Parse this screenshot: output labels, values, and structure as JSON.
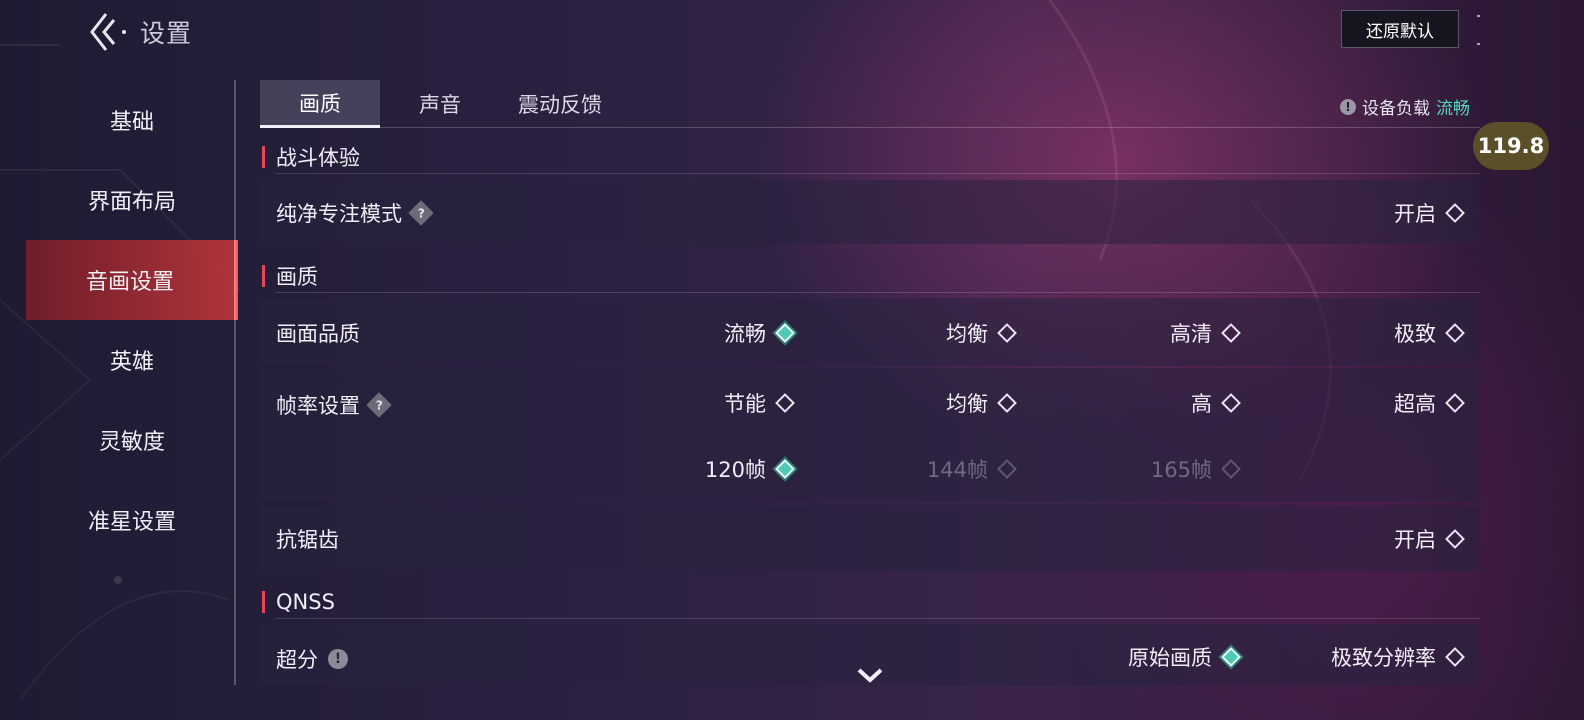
{
  "header": {
    "title": "设置",
    "reset_label": "还原默认"
  },
  "sidebar": {
    "items": [
      {
        "label": "基础"
      },
      {
        "label": "界面布局"
      },
      {
        "label": "音画设置"
      },
      {
        "label": "英雄"
      },
      {
        "label": "灵敏度"
      },
      {
        "label": "准星设置"
      }
    ],
    "active_index": 2
  },
  "tabs": [
    {
      "label": "画质"
    },
    {
      "label": "声音"
    },
    {
      "label": "震动反馈"
    }
  ],
  "device_load": {
    "label": "设备负载",
    "value": "流畅",
    "value_color": "#56d6c0"
  },
  "fps_badge": "119.8",
  "sections": {
    "battle": {
      "title": "战斗体验",
      "pure_focus": {
        "label": "纯净专注模式",
        "option": "开启"
      }
    },
    "quality": {
      "title": "画质",
      "picture_quality": {
        "label": "画面品质",
        "options": [
          "流畅",
          "均衡",
          "高清",
          "极致"
        ],
        "selected": "流畅"
      },
      "frame_rate": {
        "label": "帧率设置",
        "options": [
          "节能",
          "均衡",
          "高",
          "超高"
        ],
        "fps_options": [
          "120帧",
          "144帧",
          "165帧"
        ],
        "fps_selected": "120帧"
      },
      "anti_alias": {
        "label": "抗锯齿",
        "option": "开启"
      }
    },
    "qnss": {
      "title": "QNSS",
      "super_res": {
        "label": "超分",
        "options": [
          "原始画质",
          "极致分辨率"
        ],
        "selected": "原始画质"
      }
    }
  },
  "colors": {
    "accent_red": "#e6485a",
    "selected_teal": "#4fc8b4"
  }
}
